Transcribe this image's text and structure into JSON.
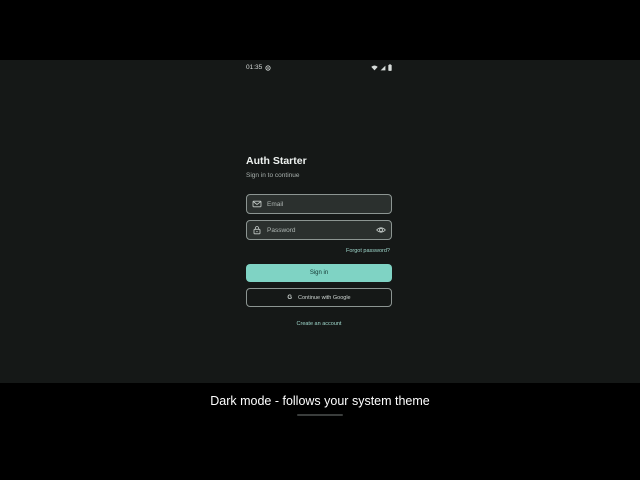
{
  "status_bar": {
    "time": "01:35",
    "icons": [
      "settings-icon",
      "wifi-icon",
      "signal-icon",
      "battery-icon"
    ]
  },
  "login": {
    "title": "Auth Starter",
    "subtitle": "Sign in to continue",
    "email": {
      "placeholder": "Email",
      "value": "",
      "icon": "mail-icon"
    },
    "password": {
      "placeholder": "Password",
      "value": "",
      "icon": "lock-icon",
      "toggle_icon": "eye-icon"
    },
    "forgot_label": "Forgot password?",
    "sign_in_label": "Sign in",
    "google": {
      "label": "Continue with Google",
      "icon_glyph": "G"
    },
    "create_label": "Create an account"
  },
  "caption": "Dark mode - follows your system theme",
  "colors": {
    "background": "#151817",
    "accent": "#7fd3c4",
    "field_border": "#8c9592",
    "link": "#9fd8cc"
  }
}
